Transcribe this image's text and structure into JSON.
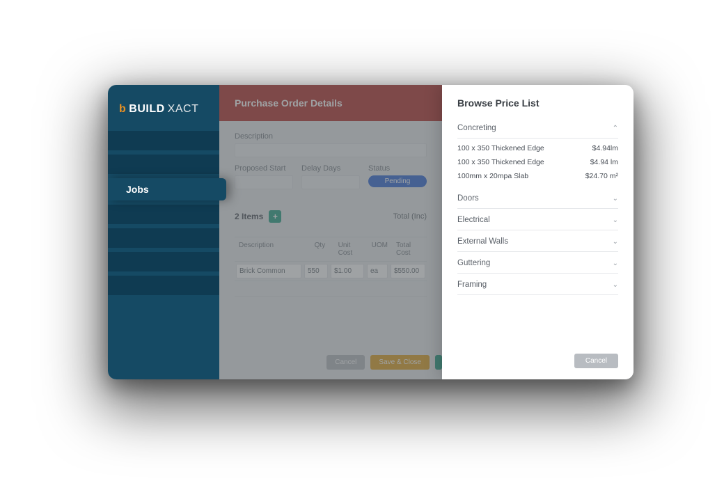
{
  "brand": {
    "b": "b",
    "bold": "BUILD",
    "thin": "XACT"
  },
  "sidebar": {
    "active_label": "Jobs"
  },
  "header": {
    "title": "Purchase Order Details"
  },
  "form": {
    "desc_label": "Description",
    "start_label": "Proposed Start",
    "delay_label": "Delay Days",
    "status_label": "Status",
    "status_value": "Pending"
  },
  "items": {
    "count_label": "2 Items",
    "total_label": "Total (Inc)",
    "columns": {
      "desc": "Description",
      "qty": "Qty",
      "unit": "Unit Cost",
      "uom": "UOM",
      "total": "Total Cost"
    },
    "row": {
      "desc": "Brick Common",
      "qty": "550",
      "unit": "$1.00",
      "uom": "ea",
      "total": "$550.00"
    }
  },
  "actions": {
    "cancel": "Cancel",
    "save": "Save & Close"
  },
  "panel": {
    "title": "Browse Price List",
    "cancel": "Cancel",
    "categories": {
      "concreting": {
        "label": "Concreting",
        "rows": [
          {
            "name": "100 x 350 Thickened Edge",
            "price": "$4.94lm"
          },
          {
            "name": "100 x 350 Thickened Edge",
            "price": "$4.94 lm"
          },
          {
            "name": "100mm x 20mpa Slab",
            "price": "$24.70 m²"
          }
        ]
      },
      "doors": {
        "label": "Doors"
      },
      "electrical": {
        "label": "Electrical"
      },
      "walls": {
        "label": "External Walls"
      },
      "guttering": {
        "label": "Guttering"
      },
      "framing": {
        "label": "Framing"
      }
    }
  }
}
